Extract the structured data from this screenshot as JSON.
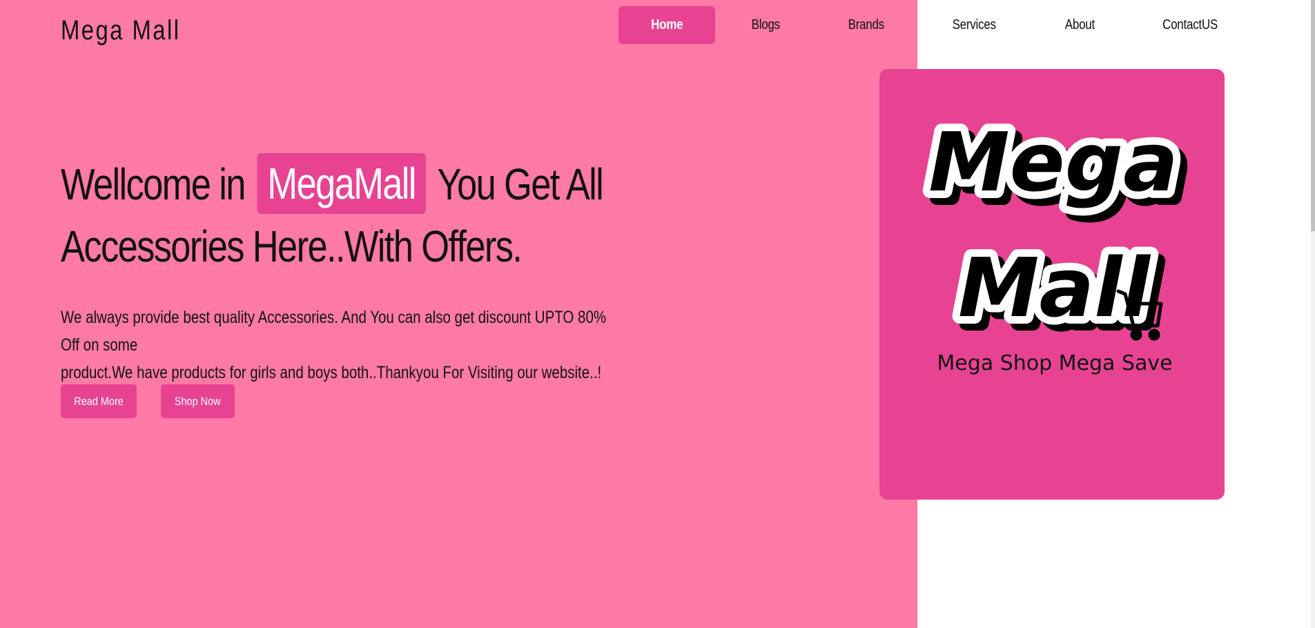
{
  "brand": "Mega Mall",
  "nav": {
    "items": [
      "Home",
      "Blogs",
      "Brands",
      "Services",
      "About",
      "ContactUS"
    ],
    "active": "Home"
  },
  "hero": {
    "title_prefix": "Wellcome in",
    "title_badge": "MegaMall",
    "title_suffix": "You Get All",
    "title_line2": "Accessories Here..With Offers.",
    "description_line1": "We always provide best quality Accessories. And You can also get discount UPTO 80% Off on some",
    "description_line2": "product.We have products for girls and boys both..Thankyou For Visiting our website..!",
    "read_more": "Read More",
    "shop_now": "Shop Now"
  },
  "logo": {
    "word1": "Mega",
    "word2": "Mall",
    "tagline": "Mega Shop Mega Save"
  },
  "colors": {
    "page_bg": "#ff7aa6",
    "accent": "#e84393",
    "text": "#111111",
    "white": "#ffffff"
  }
}
